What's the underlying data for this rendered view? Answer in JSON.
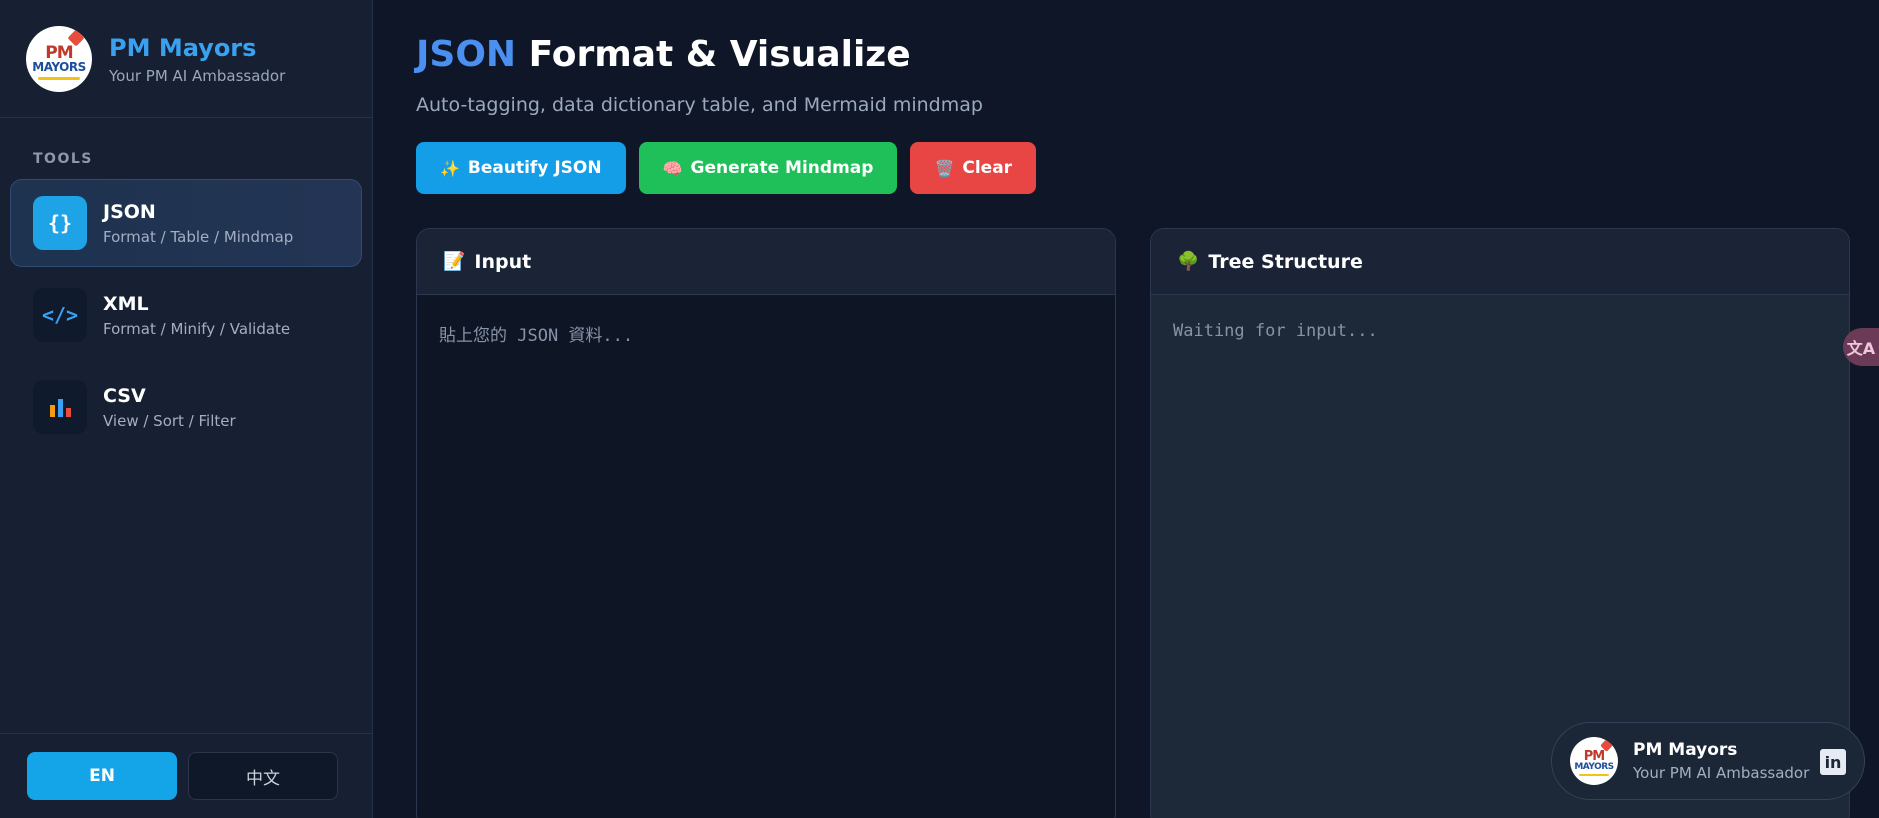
{
  "brand": {
    "name": "PM Mayors",
    "subtitle": "Your PM AI Ambassador",
    "logo_text_top": "PM",
    "logo_text_bottom": "MAYORS"
  },
  "sidebar": {
    "section_label": "TOOLS",
    "items": [
      {
        "icon": "{}",
        "icon_name": "braces-icon",
        "title": "JSON",
        "desc": "Format / Table / Mindmap",
        "active": true
      },
      {
        "icon": "</>",
        "icon_name": "code-icon",
        "title": "XML",
        "desc": "Format / Minify / Validate",
        "active": false
      },
      {
        "icon": "bars",
        "icon_name": "bar-chart-icon",
        "title": "CSV",
        "desc": "View / Sort / Filter",
        "active": false
      }
    ]
  },
  "language": {
    "en_label": "EN",
    "zh_label": "中文",
    "selected": "EN"
  },
  "main": {
    "title_accent": "JSON",
    "title_rest": "Format & Visualize",
    "subtitle": "Auto-tagging, data dictionary table, and Mermaid mindmap",
    "buttons": {
      "beautify": {
        "emoji": "✨",
        "label": "Beautify JSON"
      },
      "mindmap": {
        "emoji": "🧠",
        "label": "Generate Mindmap"
      },
      "clear": {
        "emoji": "🗑️",
        "label": "Clear"
      }
    },
    "input_panel": {
      "emoji": "📝",
      "title": "Input",
      "placeholder": "貼上您的 JSON 資料..."
    },
    "tree_panel": {
      "emoji": "🌳",
      "title": "Tree Structure",
      "status": "Waiting for input..."
    }
  },
  "translate_fab": {
    "glyph": "文A"
  },
  "profile_card": {
    "name": "PM Mayors",
    "subtitle": "Your PM AI Ambassador",
    "social": "in"
  },
  "colors": {
    "accent_blue": "#149ee8",
    "accent_green": "#1fbf5a",
    "accent_red": "#e84545",
    "brand_blue": "#3aa0f0"
  }
}
